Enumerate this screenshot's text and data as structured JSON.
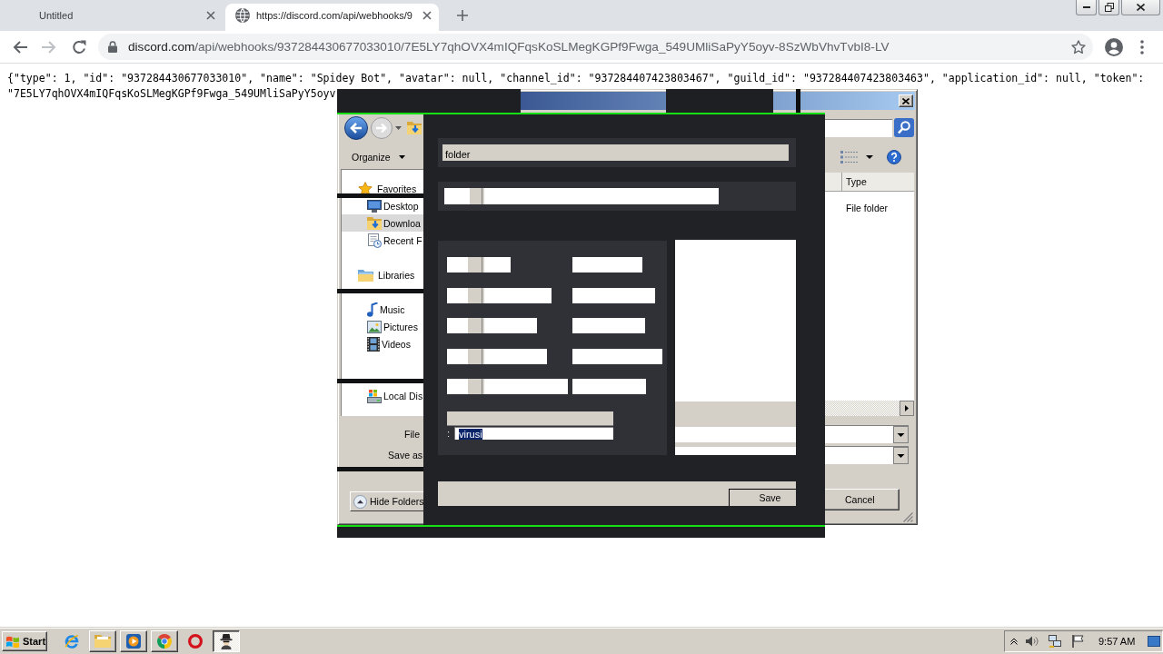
{
  "browser": {
    "tabs": [
      {
        "title": "Untitled",
        "kind": "blank",
        "selected": false
      },
      {
        "title": "https://discord.com/api/webhooks/9",
        "kind": "web",
        "selected": true
      }
    ],
    "address": {
      "host": "discord.com",
      "path": "/api/webhooks/937284430677033010/7E5LY7qhOVX4mIQFqsKoSLMegKGPf9Fwga_549UMliSaPyY5oyv-8SzWbVhvTvbI8-LV"
    }
  },
  "json_lines": [
    "{\"type\": 1, \"id\": \"937284430677033010\", \"name\": \"Spidey Bot\", \"avatar\": null, \"channel_id\": \"937284407423803467\", \"guild_id\": \"937284407423803463\", \"application_id\": null, \"token\":",
    "\"7E5LY7qhOVX4mIQFqsKoSLMegKGPf9Fwga_549UMliSaPyY5oyv"
  ],
  "save_dialog": {
    "organize": "Organize",
    "nav_pane": [
      {
        "label": "Favorites",
        "kind": "group",
        "selected": false,
        "children": [
          {
            "label": "Desktop",
            "kind": "entry",
            "selected": false
          },
          {
            "label": "Downloa",
            "kind": "entry",
            "selected": true
          },
          {
            "label": "Recent F",
            "kind": "entry",
            "selected": false
          }
        ]
      },
      {
        "label": "Libraries",
        "kind": "group",
        "selected": false,
        "children": [
          {
            "kind": "obscured",
            "selected": false
          },
          {
            "label": "Music",
            "kind": "entry",
            "selected": false
          },
          {
            "label": "Pictures",
            "kind": "entry",
            "selected": false
          },
          {
            "label": "Videos",
            "kind": "entry",
            "selected": false
          }
        ]
      },
      {
        "kind": "obscured",
        "selected": false,
        "children": [
          {
            "label": "Local Dis",
            "kind": "entry",
            "selected": false
          }
        ]
      }
    ],
    "file_name_label": "File",
    "save_type_label": "Save as",
    "hide_folders": "Hide Folders",
    "column_header": "Type",
    "rows": [
      {
        "type": "File folder"
      }
    ],
    "cancel": "Cancel"
  },
  "overlay": {
    "path": "folder",
    "file_name": {
      "label": ":",
      "value": "virusi",
      "selected": true
    },
    "save": "Save"
  },
  "taskbar": {
    "start": "Start",
    "apps": [
      {
        "kind": "plain",
        "selected": false
      },
      {
        "kind": "framed",
        "selected": false
      },
      {
        "kind": "framed",
        "selected": false
      },
      {
        "kind": "framed",
        "selected": false
      },
      {
        "kind": "plain",
        "selected": false
      },
      {
        "kind": "framed",
        "selected": true
      }
    ],
    "clock": "9:57 AM"
  }
}
